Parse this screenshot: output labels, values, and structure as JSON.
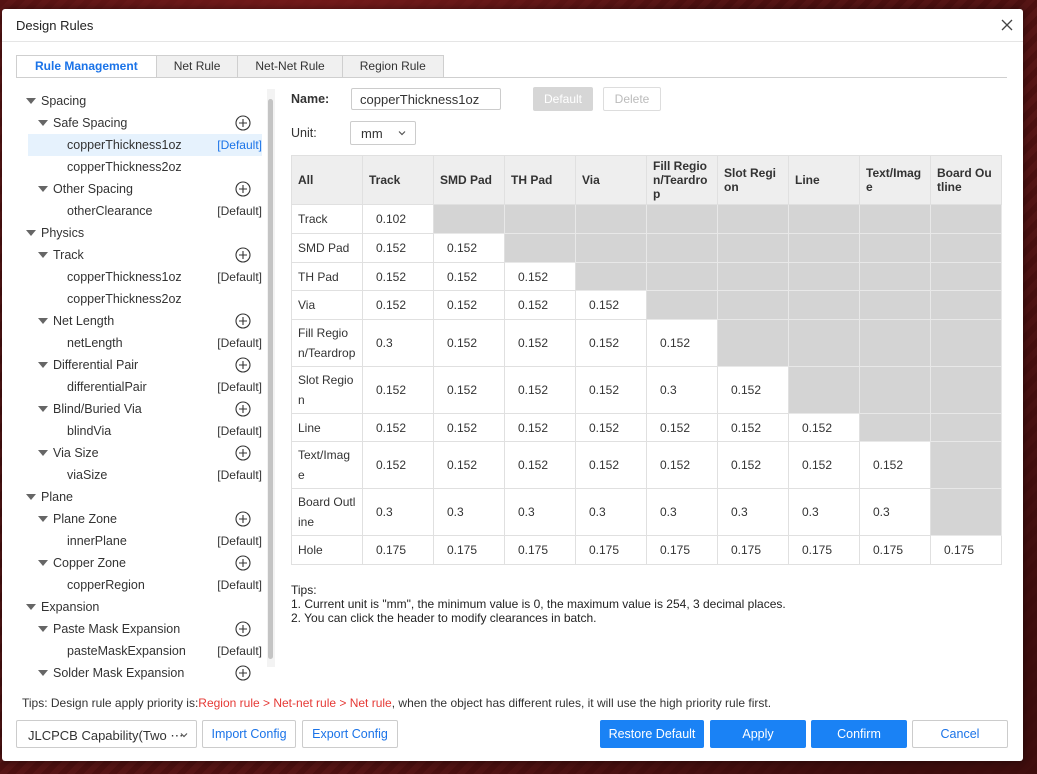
{
  "dialog": {
    "title": "Design Rules"
  },
  "tabs": [
    "Rule Management",
    "Net Rule",
    "Net-Net Rule",
    "Region Rule"
  ],
  "tree": [
    {
      "label": "Spacing",
      "level": 0
    },
    {
      "label": "Safe Spacing",
      "level": 1,
      "add": true
    },
    {
      "label": "copperThickness1oz",
      "level": 2,
      "default": "[Default]",
      "selected": true
    },
    {
      "label": "copperThickness2oz",
      "level": 2
    },
    {
      "label": "Other Spacing",
      "level": 1,
      "add": true
    },
    {
      "label": "otherClearance",
      "level": 2,
      "default": "[Default]"
    },
    {
      "label": "Physics",
      "level": 0
    },
    {
      "label": "Track",
      "level": 1,
      "add": true
    },
    {
      "label": "copperThickness1oz",
      "level": 2,
      "default": "[Default]"
    },
    {
      "label": "copperThickness2oz",
      "level": 2
    },
    {
      "label": "Net Length",
      "level": 1,
      "add": true
    },
    {
      "label": "netLength",
      "level": 2,
      "default": "[Default]"
    },
    {
      "label": "Differential Pair",
      "level": 1,
      "add": true
    },
    {
      "label": "differentialPair",
      "level": 2,
      "default": "[Default]"
    },
    {
      "label": "Blind/Buried Via",
      "level": 1,
      "add": true
    },
    {
      "label": "blindVia",
      "level": 2,
      "default": "[Default]"
    },
    {
      "label": "Via Size",
      "level": 1,
      "add": true
    },
    {
      "label": "viaSize",
      "level": 2,
      "default": "[Default]"
    },
    {
      "label": "Plane",
      "level": 0
    },
    {
      "label": "Plane Zone",
      "level": 1,
      "add": true
    },
    {
      "label": "innerPlane",
      "level": 2,
      "default": "[Default]"
    },
    {
      "label": "Copper Zone",
      "level": 1,
      "add": true
    },
    {
      "label": "copperRegion",
      "level": 2,
      "default": "[Default]"
    },
    {
      "label": "Expansion",
      "level": 0
    },
    {
      "label": "Paste Mask Expansion",
      "level": 1,
      "add": true
    },
    {
      "label": "pasteMaskExpansion",
      "level": 2,
      "default": "[Default]"
    },
    {
      "label": "Solder Mask Expansion",
      "level": 1,
      "add": true
    }
  ],
  "form": {
    "name_label": "Name:",
    "name_value": "copperThickness1oz",
    "default_btn": "Default",
    "delete_btn": "Delete",
    "unit_label": "Unit:",
    "unit_value": "mm"
  },
  "matrix": {
    "corner": "All",
    "columns": [
      "Track",
      "SMD Pad",
      "TH Pad",
      "Via",
      "Fill Regio\nn/Teardro\np",
      "Slot Regi\non",
      "Line",
      "Text/Imag\ne",
      "Board Ou\ntline"
    ],
    "rows": [
      {
        "label": "Track",
        "values": [
          "0.102"
        ]
      },
      {
        "label": "SMD Pad",
        "values": [
          "0.152",
          "0.152"
        ]
      },
      {
        "label": "TH Pad",
        "values": [
          "0.152",
          "0.152",
          "0.152"
        ]
      },
      {
        "label": "Via",
        "values": [
          "0.152",
          "0.152",
          "0.152",
          "0.152"
        ]
      },
      {
        "label": "Fill Regio\nn/Teardrop",
        "values": [
          "0.3",
          "0.152",
          "0.152",
          "0.152",
          "0.152"
        ]
      },
      {
        "label": "Slot Regio\nn",
        "values": [
          "0.152",
          "0.152",
          "0.152",
          "0.152",
          "0.3",
          "0.152"
        ]
      },
      {
        "label": "Line",
        "values": [
          "0.152",
          "0.152",
          "0.152",
          "0.152",
          "0.152",
          "0.152",
          "0.152"
        ]
      },
      {
        "label": "Text/Imag\ne",
        "values": [
          "0.152",
          "0.152",
          "0.152",
          "0.152",
          "0.152",
          "0.152",
          "0.152",
          "0.152"
        ]
      },
      {
        "label": "Board Outl\nine",
        "values": [
          "0.3",
          "0.3",
          "0.3",
          "0.3",
          "0.3",
          "0.3",
          "0.3",
          "0.3"
        ]
      },
      {
        "label": "Hole",
        "values": [
          "0.175",
          "0.175",
          "0.175",
          "0.175",
          "0.175",
          "0.175",
          "0.175",
          "0.175",
          "0.175"
        ]
      }
    ]
  },
  "tips": {
    "title": "Tips:",
    "line1": "1. Current unit is \"mm\", the minimum value is 0, the maximum value is 254, 3 decimal places.",
    "line2": "2. You can click the header to modify clearances in batch."
  },
  "priority_tip": {
    "prefix": "Tips: Design rule apply priority is:",
    "order": "Region rule > Net-net rule > Net rule",
    "suffix": ", when the object has different rules, it will use the high priority rule first."
  },
  "footer": {
    "capability": "JLCPCB Capability(Two ⋯",
    "import": "Import Config",
    "export": "Export Config",
    "restore": "Restore Default",
    "apply": "Apply",
    "confirm": "Confirm",
    "cancel": "Cancel"
  },
  "colors": {
    "primary": "#1a82f5",
    "link": "#1a73e8",
    "disabled_cell": "#d4d4d4",
    "priority_red": "#e53935"
  }
}
